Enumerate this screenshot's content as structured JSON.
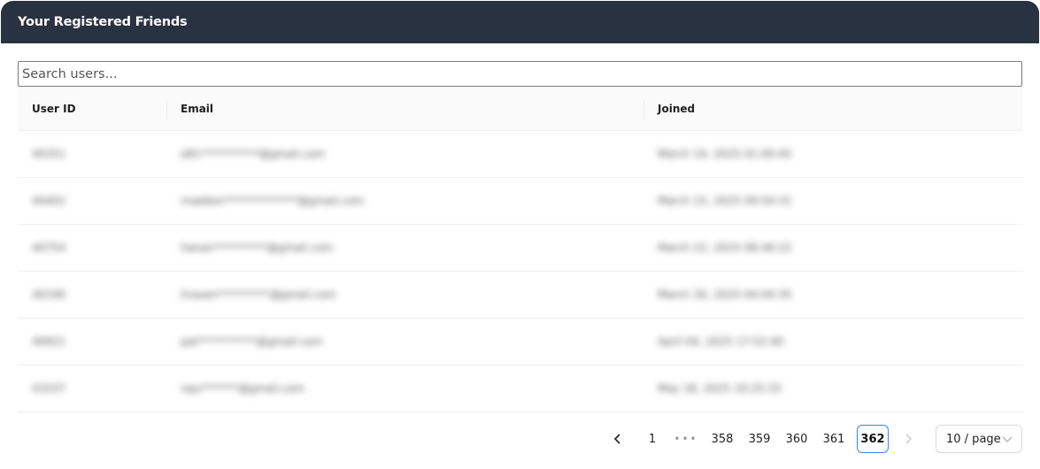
{
  "header": {
    "title": "Your Registered Friends"
  },
  "search": {
    "placeholder": "Search users..."
  },
  "table": {
    "columns": [
      "User ID",
      "Email",
      "Joined"
    ],
    "rows": [
      {
        "id": "40351",
        "email": "a81***********@gmail.com",
        "joined": "March 10, 2025 01:00:45"
      },
      {
        "id": "40402",
        "email": "maddox**************@gmail.com",
        "joined": "March 15, 2025 09:59:31"
      },
      {
        "id": "40754",
        "email": "hanan**********@gmail.com",
        "joined": "March 22, 2025 08:46:22"
      },
      {
        "id": "40190",
        "email": "hrasan**********@gmail.com",
        "joined": "March 30, 2025 04:04:35"
      },
      {
        "id": "40921",
        "email": "pat***********@gmail.com",
        "joined": "April 04, 2025 17:52:40"
      },
      {
        "id": "41037",
        "email": "raju*******@gmail.com",
        "joined": "May 18, 2025 10:25:33"
      }
    ]
  },
  "pagination": {
    "prev_icon": "chevron-left-icon",
    "next_icon": "chevron-right-icon",
    "pages": [
      "1",
      "•••",
      "358",
      "359",
      "360",
      "361",
      "362"
    ],
    "current": "362",
    "page_size": "10 / page"
  }
}
